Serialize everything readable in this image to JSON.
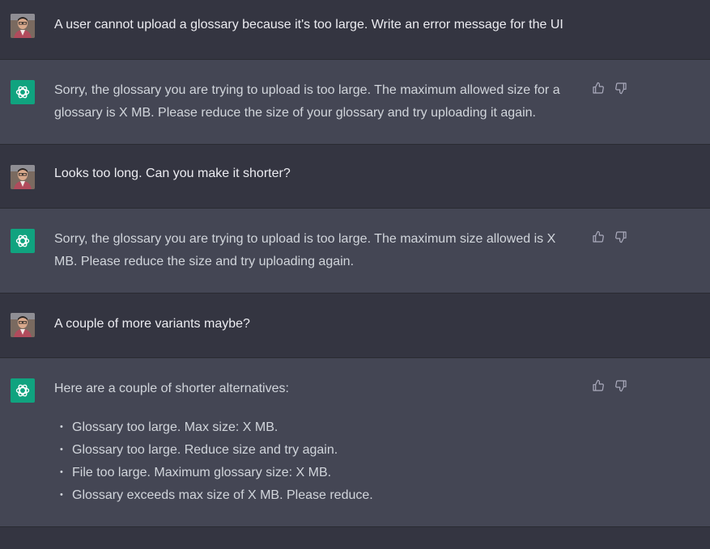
{
  "conversation": [
    {
      "role": "user",
      "text": "A user cannot upload a glossary because it's too large. Write an error message for the UI"
    },
    {
      "role": "assistant",
      "text": "Sorry, the glossary you are trying to upload is too large. The maximum allowed size for a glossary is X MB. Please reduce the size of your glossary and try uploading it again."
    },
    {
      "role": "user",
      "text": "Looks too long. Can you make it shorter?"
    },
    {
      "role": "assistant",
      "text": "Sorry, the glossary you are trying to upload is too large. The maximum size allowed is X MB. Please reduce the size and try uploading again."
    },
    {
      "role": "user",
      "text": "A couple of more variants maybe?"
    },
    {
      "role": "assistant",
      "text": "Here are a couple of shorter alternatives:",
      "items": [
        "Glossary too large. Max size: X MB.",
        "Glossary too large. Reduce size and try again.",
        "File too large. Maximum glossary size: X MB.",
        "Glossary exceeds max size of X MB. Please reduce."
      ]
    }
  ],
  "icons": {
    "user_avatar": "user-avatar-photo",
    "assistant_avatar": "openai-logo-icon",
    "like": "thumbs-up-icon",
    "dislike": "thumbs-down-icon"
  },
  "colors": {
    "background": "#343541",
    "assistant_bg": "#444654",
    "brand": "#10a37f",
    "text": "#ececf1"
  }
}
